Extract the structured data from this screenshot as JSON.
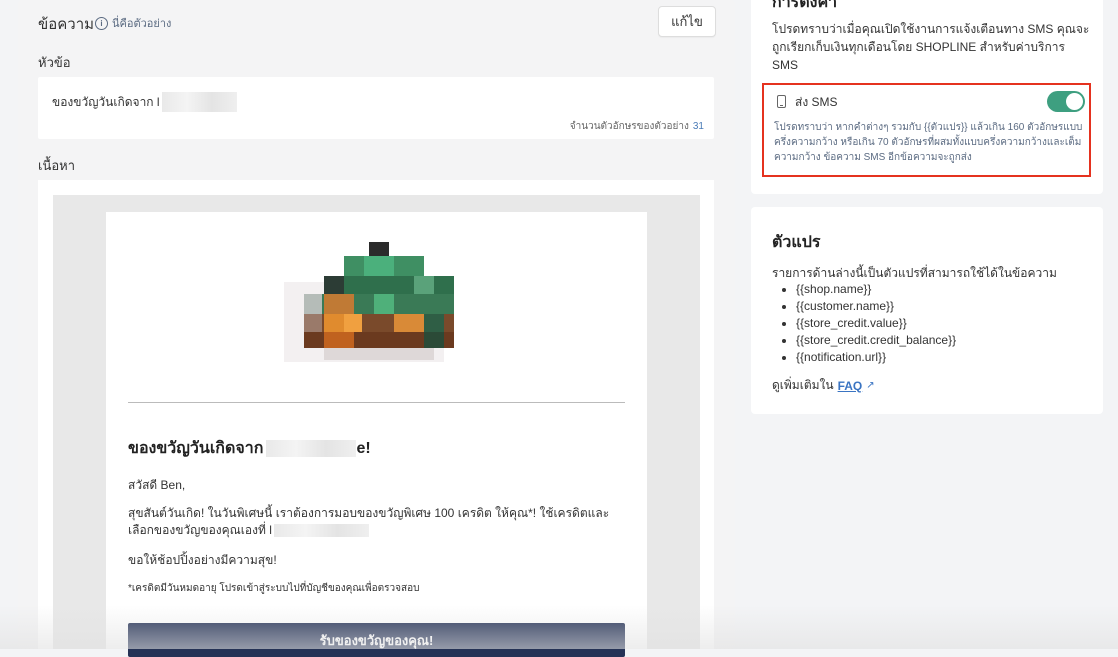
{
  "message": {
    "title": "ข้อความ",
    "hint": "นี่คือตัวอย่าง",
    "edit_label": "แก้ไข"
  },
  "subject": {
    "label": "หัวข้อ",
    "value_prefix": "ของขวัญวันเกิดจาก l",
    "char_count_label": "จำนวนตัวอักษรของตัวอย่าง",
    "char_count": "31"
  },
  "body": {
    "label": "เนื้อหา",
    "email": {
      "heading_prefix": "ของขวัญวันเกิดจาก",
      "heading_suffix": "e!",
      "greeting": "สวัสดี Ben,",
      "paragraph_line1": "สุขสันต์วันเกิด! ในวันพิเศษนี้ เราต้องการมอบของขวัญพิเศษ 100 เครดิต ให้คุณ*! ใช้เครดิตและ",
      "paragraph_line2": "เลือกของขวัญของคุณเองที่ l",
      "closing": "ขอให้ช้อปปิ้งอย่างมีความสุข!",
      "footnote": "*เครดิตมีวันหมดอายุ โปรดเข้าสู่ระบบไปที่บัญชีของคุณเพื่อตรวจสอบ",
      "cta_label": "รับของขวัญของคุณ!",
      "cta_color": "#253256"
    }
  },
  "settings": {
    "title": "การตั้งค่า",
    "sms_description": "โปรดทราบว่าเมื่อคุณเปิดใช้งานการแจ้งเตือนทาง SMS คุณจะถูกเรียกเก็บเงินทุกเดือนโดย SHOPLINE สำหรับค่าบริการ SMS",
    "sms_label": "ส่ง SMS",
    "sms_enabled": true,
    "toggle_color": "#3e9f80",
    "highlight_color": "#e5321f",
    "sms_note": "โปรดทราบว่า หากคำต่างๆ รวมกับ {{ตัวแปร}} แล้วเกิน 160 ตัวอักษรแบบครึ่งความกว้าง หรือเกิน 70 ตัวอักษรที่ผสมทั้งแบบครึ่งความกว้างและเต็มความกว้าง ข้อความ SMS อีกข้อความจะถูกส่ง"
  },
  "variables": {
    "title": "ตัวแปร",
    "description": "รายการด้านล่างนี้เป็นตัวแปรที่สามารถใช้ได้ในข้อความ",
    "items": [
      "{{shop.name}}",
      "{{customer.name}}",
      "{{store_credit.value}}",
      "{{store_credit.credit_balance}}",
      "{{notification.url}}"
    ],
    "see_more_label": "ดูเพิ่มเติมใน",
    "faq_label": "FAQ",
    "icons": {
      "external_link": "external-link-icon",
      "phone": "phone-icon",
      "info": "info-icon"
    }
  }
}
